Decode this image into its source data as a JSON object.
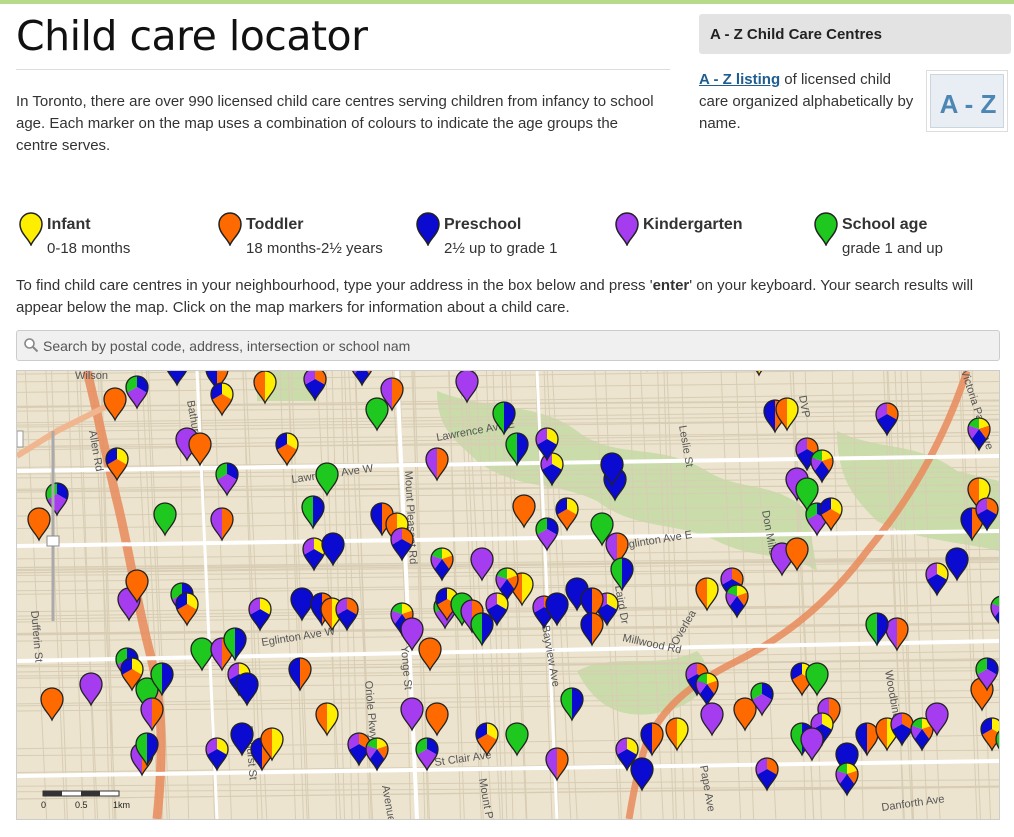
{
  "header": {
    "title": "Child care locator"
  },
  "intro": "In Toronto, there are over 990 licensed child care centres serving children from infancy to school age. Each marker on the map uses a combination of colours to indicate the age groups the centre serves.",
  "sidebar": {
    "heading": "A - Z Child Care Centres",
    "link_label": "A - Z listing",
    "text": " of licensed child care organized alphabetically by name.",
    "logo_text": "A - Z"
  },
  "legend": [
    {
      "name": "Infant",
      "range": "0-18 months",
      "color": "#ffee00"
    },
    {
      "name": "Toddler",
      "range": "18 months-2½ years",
      "color": "#ff6a00"
    },
    {
      "name": "Preschool",
      "range": "2½ up to grade 1",
      "color": "#0a0ad0"
    },
    {
      "name": "Kindergarten",
      "range": "",
      "color": "#a63cf0"
    },
    {
      "name": "School age",
      "range": "grade 1 and up",
      "color": "#1ec81e"
    }
  ],
  "instructions": {
    "part1": "To find child care centres in your neighbourhood, type your address in the box below and press '",
    "key": "enter",
    "part2": "' on your keyboard. Your search results will appear below the map. Click on the map markers for information about a child care."
  },
  "search": {
    "placeholder": "Search by postal code, address, intersection or school nam"
  },
  "map": {
    "street_labels": [
      "Wilson",
      "Lawrence Ave W",
      "Lawrence Ave E",
      "Mount Pleasant Rd",
      "Eglinton Ave E",
      "Eglinton Ave W",
      "Bayview Ave",
      "Laird Dr",
      "Millwood Rd",
      "Overlea",
      "Don Mills",
      "Leslie St",
      "DVP",
      "Victoria Park Ave",
      "Dufferin St",
      "Allen Rd",
      "Bathurst St",
      "Oriole Pkwy",
      "Yonge St",
      "St Clair Ave",
      "Pape Ave",
      "Danforth Ave",
      "Woodbine",
      "Bathurst",
      "Avenue Rd",
      "Mount Pleasant Rd"
    ],
    "scale_labels": [
      "0",
      "0.5",
      "1km"
    ],
    "pin_color_names": [
      "infant-yellow",
      "toddler-orange",
      "preschool-blue",
      "kindergarten-purple",
      "schoolage-green"
    ]
  }
}
